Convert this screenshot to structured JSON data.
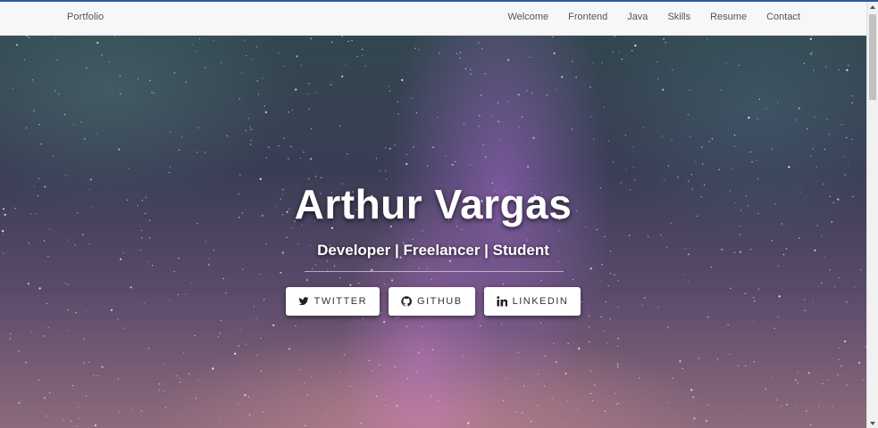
{
  "navbar": {
    "brand": "Portfolio",
    "links": [
      "Welcome",
      "Frontend",
      "Java",
      "Skills",
      "Resume",
      "Contact"
    ]
  },
  "hero": {
    "title": "Arthur Vargas",
    "subtitle": "Developer | Freelancer | Student",
    "buttons": [
      {
        "label": "TWITTER",
        "icon": "twitter-icon"
      },
      {
        "label": "GITHUB",
        "icon": "github-icon"
      },
      {
        "label": "LINKEDIN",
        "icon": "linkedin-icon"
      }
    ]
  },
  "colors": {
    "accent_bar": "#2a56a8",
    "navbar_bg": "#f7f7f7",
    "nav_text": "#555555",
    "button_bg": "#ffffff"
  }
}
